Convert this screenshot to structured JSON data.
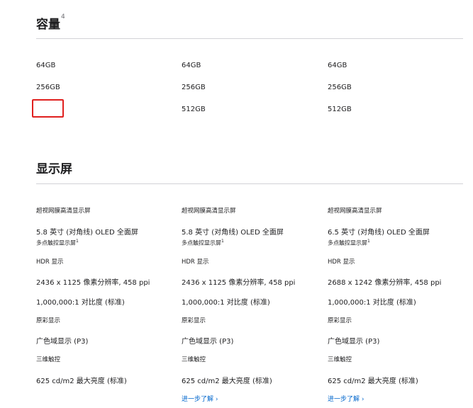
{
  "capacity": {
    "title": "容量",
    "footnote": "4",
    "columns": [
      [
        "64GB",
        "256GB",
        ""
      ],
      [
        "64GB",
        "256GB",
        "512GB"
      ],
      [
        "64GB",
        "256GB",
        "512GB"
      ]
    ]
  },
  "display": {
    "title": "显示屏",
    "columns": [
      {
        "type": "超视网膜高清显示屏",
        "size": "5.8 英寸 (对角线) OLED 全面屏",
        "touch": "多点触控显示屏",
        "touch_footnote": "1",
        "hdr": "HDR 显示",
        "resolution": "2436 x 1125 像素分辨率, 458 ppi",
        "contrast": "1,000,000:1 对比度 (标准)",
        "true_tone": "原彩显示",
        "wide_color": "广色域显示 (P3)",
        "touch3d": "三维触控",
        "brightness": "625 cd/m2 最大亮度 (标准)",
        "learn_more": ""
      },
      {
        "type": "超视网膜高清显示屏",
        "size": "5.8 英寸 (对角线) OLED 全面屏",
        "touch": "多点触控显示屏",
        "touch_footnote": "1",
        "hdr": "HDR 显示",
        "resolution": "2436 x 1125 像素分辨率, 458 ppi",
        "contrast": "1,000,000:1 对比度 (标准)",
        "true_tone": "原彩显示",
        "wide_color": "广色域显示 (P3)",
        "touch3d": "三维触控",
        "brightness": "625 cd/m2 最大亮度 (标准)",
        "learn_more": "进一步了解 ›"
      },
      {
        "type": "超视网膜高清显示屏",
        "size": "6.5 英寸 (对角线) OLED 全面屏",
        "touch": "多点触控显示屏",
        "touch_footnote": "1",
        "hdr": "HDR 显示",
        "resolution": "2688 x 1242 像素分辨率, 458 ppi",
        "contrast": "1,000,000:1 对比度 (标准)",
        "true_tone": "原彩显示",
        "wide_color": "广色域显示 (P3)",
        "touch3d": "三维触控",
        "brightness": "625 cd/m2 最大亮度 (标准)",
        "learn_more": "进一步了解 ›"
      }
    ]
  },
  "colors": {
    "highlight": "#e0201e",
    "link": "#0066cc",
    "divider": "#d2d2d7"
  }
}
